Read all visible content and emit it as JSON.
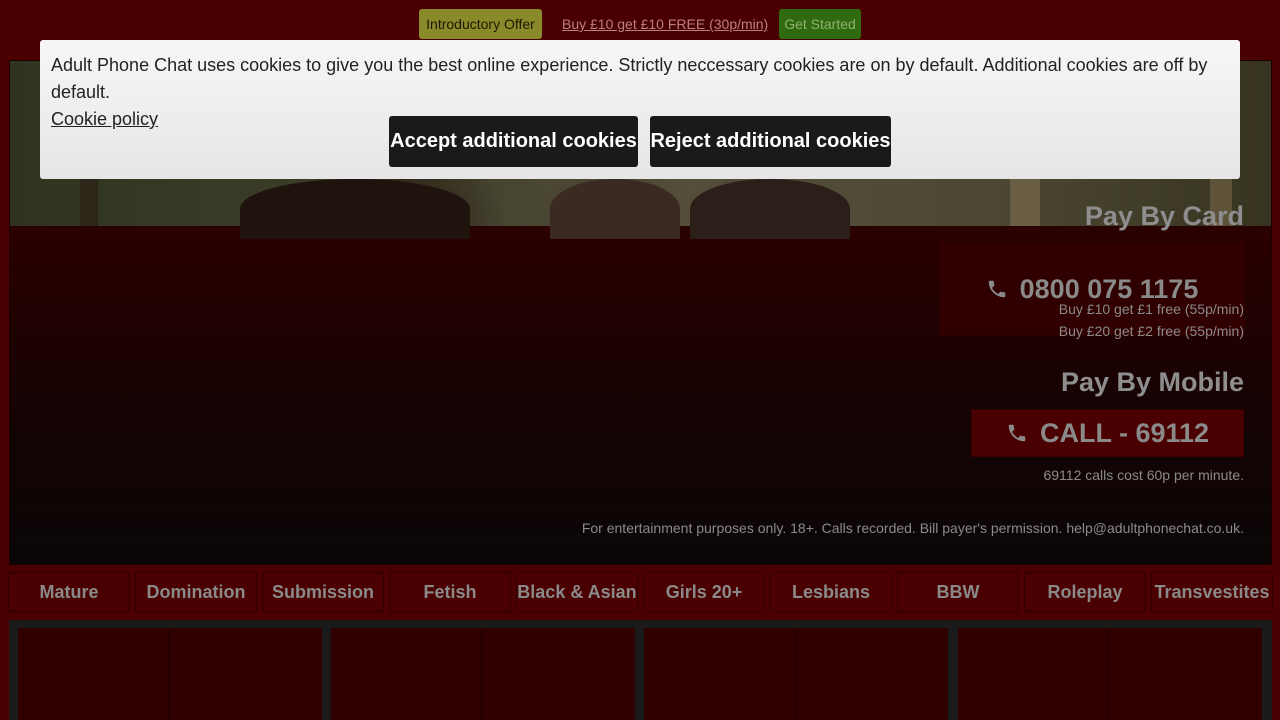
{
  "promo": {
    "intro_label": "Introductory Offer",
    "offer_link": "Buy £10 get £10 FREE (30p/min)",
    "start_label": "Get Started"
  },
  "hero": {
    "pay_card_title": "Pay By Card",
    "card_number": "0800 075 1175",
    "card_note_1": "Buy £10 get £1 free (55p/min)",
    "card_note_2": "Buy £20 get £2 free (55p/min)",
    "pay_mobile_title": "Pay By Mobile",
    "mobile_number": "CALL - 69112",
    "mobile_note": "69112 calls cost 60p per minute.",
    "disclaimer": "For entertainment purposes only. 18+. Calls recorded. Bill payer's permission. help@adultphonechat.co.uk."
  },
  "categories": [
    "Mature",
    "Domination",
    "Submission",
    "Fetish",
    "Black & Asian",
    "Girls 20+",
    "Lesbians",
    "BBW",
    "Roleplay",
    "Transvestites"
  ],
  "cookie_banner": {
    "message": "Adult Phone Chat uses cookies to give you the best online experience. Strictly neccessary cookies are on by default. Additional cookies are off by default.",
    "policy_link": "Cookie policy",
    "accept_label": "Accept additional cookies",
    "reject_label": "Reject additional cookies"
  },
  "icons": {
    "phone": "phone-icon"
  },
  "colors": {
    "background": "#4a0000",
    "intro_badge": "#8a8a2a",
    "start_badge": "#2f6a10",
    "cookie_button": "#1a1a1a"
  }
}
